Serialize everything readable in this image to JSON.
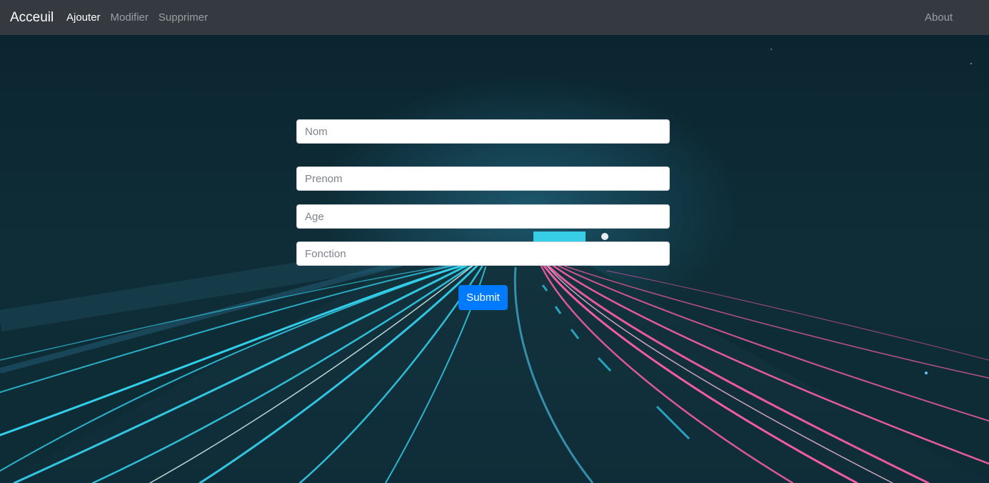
{
  "navbar": {
    "brand": "Acceuil",
    "links": [
      {
        "label": "Ajouter",
        "active": true
      },
      {
        "label": "Modifier",
        "active": false
      },
      {
        "label": "Supprimer",
        "active": false
      }
    ],
    "about": "About"
  },
  "form": {
    "nom_placeholder": "Nom",
    "prenom_placeholder": "Prenom",
    "age_placeholder": "Age",
    "fonction_placeholder": "Fonction",
    "submit_label": "Submit"
  },
  "colors": {
    "navbar_bg": "#343a40",
    "primary_button": "#007bff",
    "light_trail_cyan": "#2fd8f0",
    "light_trail_pink": "#ff5fa8"
  }
}
